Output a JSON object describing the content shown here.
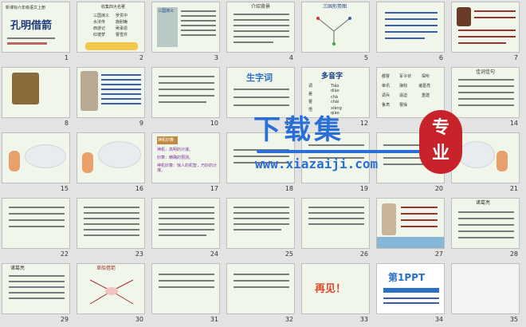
{
  "slides": [
    {
      "n": "1",
      "title": "孔明借箭",
      "sub": "新课标六年级语文上册"
    },
    {
      "n": "2",
      "lines": [
        "收集四大名著",
        "三国演义",
        "罗贯中",
        "水浒传",
        "施耐庵",
        "西游记",
        "吴承恩",
        "红楼梦",
        "曹雪芹"
      ]
    },
    {
      "n": "3",
      "badge": "三国演义"
    },
    {
      "n": "4",
      "heading": "介绍背景"
    },
    {
      "n": "5",
      "heading": "三国形势图"
    },
    {
      "n": "6"
    },
    {
      "n": "7"
    },
    {
      "n": "8"
    },
    {
      "n": "9"
    },
    {
      "n": "10"
    },
    {
      "n": "11",
      "heading": "生字词"
    },
    {
      "n": "12",
      "heading": "多音字",
      "items": [
        "调",
        "差",
        "曹",
        "悟",
        "Tiáo",
        "diào",
        "chà",
        "chāi",
        "xiàng",
        "qiào"
      ]
    },
    {
      "n": "13",
      "items": [
        "都督",
        "军令状",
        "探听",
        "审讯",
        "弹劾",
        "诸葛亮",
        "调兵",
        "逼迫",
        "重建",
        "鲁肃",
        "曹操"
      ]
    },
    {
      "n": "14",
      "heading": "佳词佳句"
    },
    {
      "n": "15"
    },
    {
      "n": "16"
    },
    {
      "n": "17",
      "badge": "神机妙算",
      "lines": [
        "神机：高明的计谋。",
        "妙算：精确的预测。",
        "神机妙算：惊人的机智，巧妙的计谋。"
      ]
    },
    {
      "n": "18"
    },
    {
      "n": "19"
    },
    {
      "n": "20"
    },
    {
      "n": "21"
    },
    {
      "n": "22"
    },
    {
      "n": "23"
    },
    {
      "n": "24"
    },
    {
      "n": "25"
    },
    {
      "n": "26"
    },
    {
      "n": "27"
    },
    {
      "n": "28",
      "heading": "诸葛亮"
    },
    {
      "n": "29",
      "heading": "诸葛亮"
    },
    {
      "n": "30",
      "heading": "草船借箭"
    },
    {
      "n": "31"
    },
    {
      "n": "32"
    },
    {
      "n": "33",
      "heading": "再见！"
    },
    {
      "n": "34",
      "heading": "第1PPT"
    },
    {
      "n": "35"
    }
  ],
  "watermark": {
    "text": "下载集",
    "url": "www.xiazaiji.com",
    "badge": [
      "专",
      "业"
    ]
  }
}
